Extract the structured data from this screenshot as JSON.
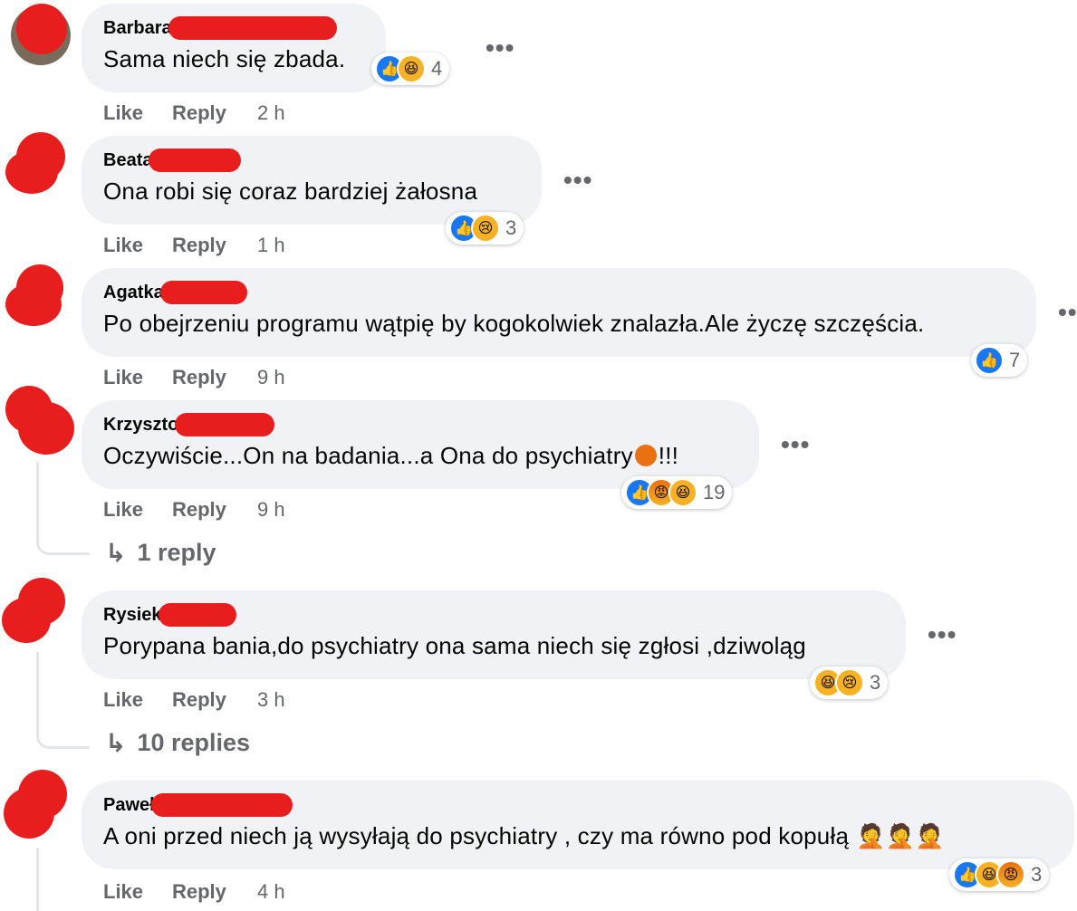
{
  "common": {
    "like_label": "Like",
    "reply_label": "Reply",
    "more_icon": "more-horizontal-icon",
    "dots": "•••"
  },
  "comments": [
    {
      "author": "Barbara",
      "text": "Sama niech się zbada.",
      "time": "2 h",
      "reaction_count": "4",
      "reactions": [
        "like",
        "haha"
      ]
    },
    {
      "author": "Beata",
      "text": "Ona robi się coraz bardziej żałosna",
      "time": "1 h",
      "reaction_count": "3",
      "reactions": [
        "like",
        "sad"
      ]
    },
    {
      "author": "Agatka",
      "text": "Po obejrzeniu programu wątpię by kogokolwiek znalazła.Ale życzę szczęścia.",
      "time": "9 h",
      "reaction_count": "7",
      "reactions": [
        "like"
      ]
    },
    {
      "author": "Krzyszto",
      "text": "Oczywiście...On na badania...a Ona do psychiatry",
      "text_suffix": "!!!",
      "time": "9 h",
      "reaction_count": "19",
      "reactions": [
        "like",
        "angry",
        "haha"
      ],
      "replies_label": "1 reply"
    },
    {
      "author": "Rysiek",
      "text": "Porypana bania,do psychiatry ona sama niech się zgłosi ,dziwoląg",
      "time": "3 h",
      "reaction_count": "3",
      "reactions": [
        "haha",
        "sad"
      ],
      "replies_label": "10 replies"
    },
    {
      "author": "Paweł",
      "text": "A oni przed niech ją wysyłają do psychiatry , czy ma równo pod kopułą",
      "time": "4 h",
      "reaction_count": "3",
      "reactions": [
        "like",
        "haha",
        "angry"
      ]
    }
  ],
  "colors": {
    "bubble": "#f0f2f5",
    "meta": "#65676b",
    "like_blue": "#1877f2",
    "redaction": "#e81e1e"
  }
}
